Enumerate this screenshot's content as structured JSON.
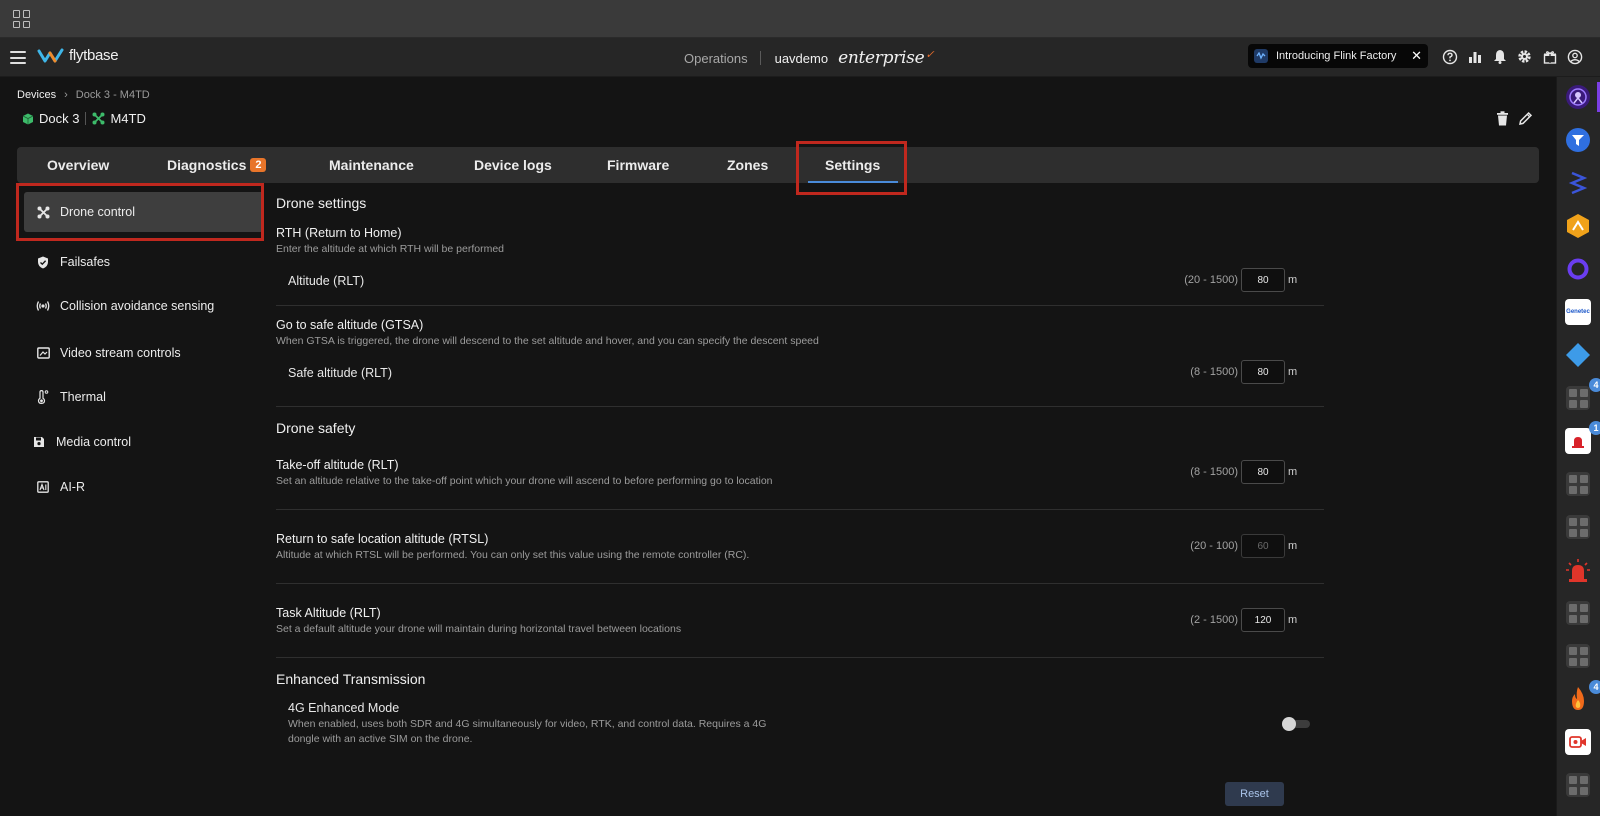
{
  "header": {
    "brand": "flytbase",
    "operations": "Operations",
    "org": "uavdemo",
    "edition": "enterprise",
    "announcement": "Introducing Flink Factory"
  },
  "breadcrumb": {
    "root": "Devices",
    "current": "Dock 3 - M4TD"
  },
  "device": {
    "dock": "Dock 3",
    "drone": "M4TD"
  },
  "tabs": [
    {
      "label": "Overview"
    },
    {
      "label": "Diagnostics",
      "badge": "2"
    },
    {
      "label": "Maintenance"
    },
    {
      "label": "Device logs"
    },
    {
      "label": "Firmware"
    },
    {
      "label": "Zones"
    },
    {
      "label": "Settings",
      "active": true
    }
  ],
  "sidebar": [
    {
      "label": "Drone control",
      "active": true,
      "icon": "drone-icon"
    },
    {
      "label": "Failsafes",
      "icon": "shield-icon"
    },
    {
      "label": "Collision avoidance sensing",
      "icon": "sensor-icon"
    },
    {
      "label": "Video stream controls",
      "icon": "video-icon"
    },
    {
      "label": "Thermal",
      "icon": "thermometer-icon"
    },
    {
      "label": "Media control",
      "icon": "media-icon"
    },
    {
      "label": "AI-R",
      "icon": "ai-icon"
    }
  ],
  "sections": {
    "drone_settings": "Drone settings",
    "drone_safety": "Drone safety",
    "enhanced_transmission": "Enhanced Transmission"
  },
  "rth": {
    "title": "RTH (Return to Home)",
    "desc": "Enter the altitude at which RTH will be performed",
    "label": "Altitude (RLT)",
    "range": "(20 - 1500)",
    "value": "80",
    "unit": "m"
  },
  "gtsa": {
    "title": "Go to safe altitude (GTSA)",
    "desc": "When GTSA is triggered, the drone will descend to the set altitude and hover, and you can specify the descent speed",
    "label": "Safe altitude (RLT)",
    "range": "(8 - 1500)",
    "value": "80",
    "unit": "m"
  },
  "takeoff": {
    "title": "Take-off altitude (RLT)",
    "desc": "Set an altitude relative to the take-off point which your drone will ascend to before performing go to location",
    "range": "(8 - 1500)",
    "value": "80",
    "unit": "m"
  },
  "rtsl": {
    "title": "Return to safe location altitude (RTSL)",
    "desc": "Altitude at which RTSL will be performed. You can only set this value using the remote controller (RC).",
    "range": "(20 - 100)",
    "value": "60",
    "unit": "m"
  },
  "task": {
    "title": "Task Altitude (RLT)",
    "desc": "Set a default altitude your drone will maintain during horizontal travel between locations",
    "range": "(2 - 1500)",
    "value": "120",
    "unit": "m"
  },
  "enhanced": {
    "title": "4G Enhanced Mode",
    "desc1": "When enabled, uses both SDR and 4G simultaneously for video, RTK, and control data. Requires a 4G",
    "desc2": "dongle with an active SIM on the drone.",
    "enabled": false
  },
  "reset_label": "Reset",
  "rail": {
    "badges": [
      "4",
      "1",
      "4"
    ],
    "apps": [
      "globe-app-icon",
      "navigation-app-icon",
      "stack-app-icon",
      "hexagon-app-icon",
      "ring-app-icon",
      "genetec-app-icon",
      "diamond-app-icon",
      "placeholder-app-icon",
      "alarm-app-icon",
      "placeholder-app-icon",
      "placeholder-app-icon",
      "siren-app-icon",
      "placeholder-app-icon",
      "placeholder-app-icon",
      "fire-app-icon",
      "camera-app-icon",
      "placeholder-app-icon"
    ],
    "genetec_label": "Genetec"
  },
  "colors": {
    "accent": "#4a8bd9",
    "badge": "#e8752a",
    "highlight": "#c0281e",
    "active_bg": "#3e3e3e"
  }
}
